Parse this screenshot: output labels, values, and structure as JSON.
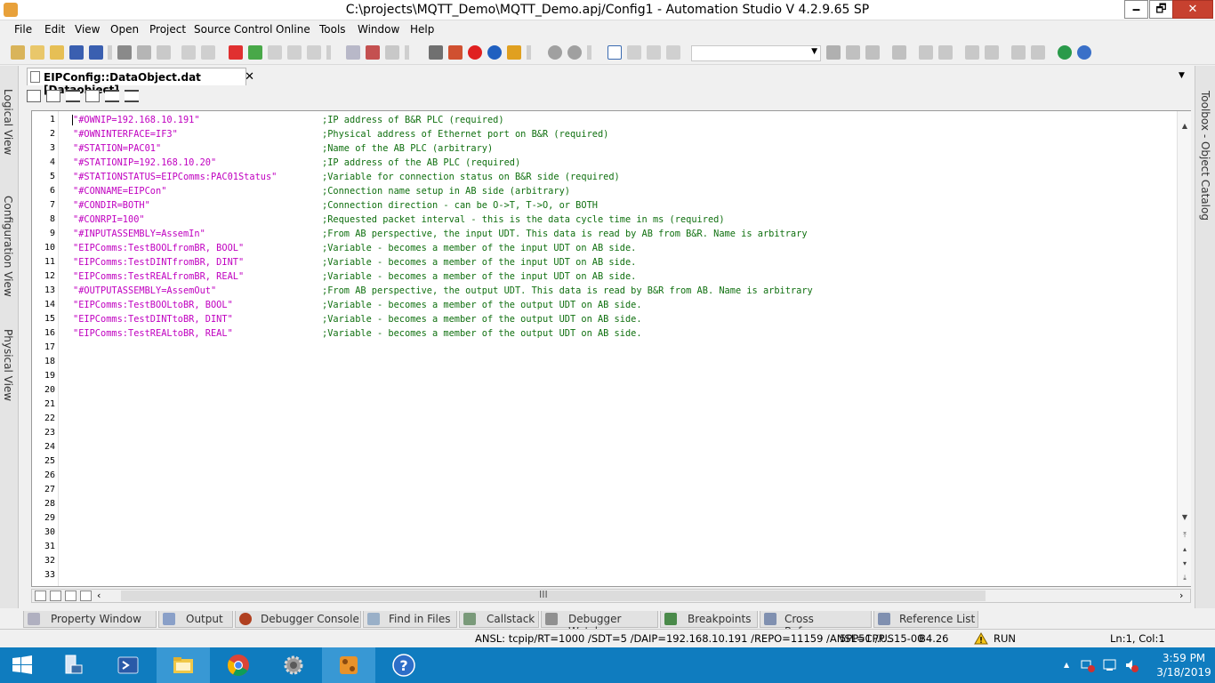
{
  "window": {
    "title": "C:\\projects\\MQTT_Demo\\MQTT_Demo.apj/Config1 - Automation Studio V 4.2.9.65 SP",
    "minimize": "🗕",
    "maximize": "🗗",
    "close": "✕"
  },
  "menu": [
    "File",
    "Edit",
    "View",
    "Open",
    "Project",
    "Source Control",
    "Online",
    "Tools",
    "Window",
    "Help"
  ],
  "side_panels": {
    "left": [
      "Logical View",
      "Configuration View",
      "Physical View"
    ],
    "right": [
      "Toolbox - Object Catalog"
    ]
  },
  "document_tab": {
    "label": "EIPConfig::DataObject.dat [Dataobject]",
    "close": "✕"
  },
  "editor": {
    "line_numbers": [
      "1",
      "2",
      "3",
      "4",
      "5",
      "6",
      "7",
      "8",
      "9",
      "10",
      "11",
      "12",
      "13",
      "14",
      "15",
      "16",
      "17",
      "18",
      "19",
      "20",
      "21",
      "22",
      "23",
      "24",
      "25",
      "26",
      "27",
      "28",
      "29",
      "30",
      "31",
      "32",
      "33"
    ],
    "lines": [
      {
        "code": "\"#OWNIP=192.168.10.191\"",
        "comment": ";IP address of B&R PLC (required)"
      },
      {
        "code": "\"#OWNINTERFACE=IF3\"",
        "comment": ";Physical address of Ethernet port on B&R (required)"
      },
      {
        "code": "\"#STATION=PAC01\"",
        "comment": ";Name of the AB PLC (arbitrary)"
      },
      {
        "code": "\"#STATIONIP=192.168.10.20\"",
        "comment": ";IP address of the AB PLC (required)"
      },
      {
        "code": "\"#STATIONSTATUS=EIPComms:PAC01Status\"",
        "comment": ";Variable for connection status on B&R side (required)"
      },
      {
        "code": "\"#CONNAME=EIPCon\"",
        "comment": ";Connection name setup in AB side (arbitrary)"
      },
      {
        "code": "\"#CONDIR=BOTH\"",
        "comment": ";Connection direction - can be O->T, T->O, or BOTH"
      },
      {
        "code": "\"#CONRPI=100\"",
        "comment": ";Requested packet interval - this is the data cycle time in ms (required)"
      },
      {
        "code": "\"#INPUTASSEMBLY=AssemIn\"",
        "comment": ";From AB perspective, the input UDT. This data is read by AB from B&R. Name is arbitrary"
      },
      {
        "code": "\"EIPComms:TestBOOLfromBR, BOOL\"",
        "comment": ";Variable - becomes a member of the input UDT on AB side."
      },
      {
        "code": "\"EIPComms:TestDINTfromBR, DINT\"",
        "comment": ";Variable - becomes a member of the input UDT on AB side."
      },
      {
        "code": "\"EIPComms:TestREALfromBR, REAL\"",
        "comment": ";Variable - becomes a member of the input UDT on AB side."
      },
      {
        "code": "\"#OUTPUTASSEMBLY=AssemOut\"",
        "comment": ";From AB perspective, the output UDT. This data is read by B&R from AB. Name is arbitrary"
      },
      {
        "code": "\"EIPComms:TestBOOLtoBR, BOOL\"",
        "comment": ";Variable - becomes a member of the output UDT on AB side."
      },
      {
        "code": "\"EIPComms:TestDINTtoBR, DINT\"",
        "comment": ";Variable - becomes a member of the output UDT on AB side."
      },
      {
        "code": "\"EIPComms:TestREALtoBR, REAL\"",
        "comment": ";Variable - becomes a member of the output UDT on AB side."
      }
    ]
  },
  "bottom_tabs": [
    "Property Window",
    "Output",
    "Debugger Console",
    "Find in Files",
    "Callstack",
    "Debugger Watch",
    "Breakpoints",
    "Cross Reference",
    "Reference List"
  ],
  "status_bar": {
    "connection": "ANSL: tcpip/RT=1000 /SDT=5 /DAIP=192.168.10.191 /REPO=11159 /ANSL=1 /P...",
    "target": "5PP5CP.US15-00",
    "version": "B4.26",
    "mode": "RUN",
    "position": "Ln:1, Col:1"
  },
  "taskbar": {
    "time": "3:59 PM",
    "date": "3/18/2019",
    "tray_arrow": "▲"
  },
  "colors": {
    "code": "#c000c0",
    "comment": "#107010",
    "taskbar": "#0f7cbf",
    "close_button": "#c7412f"
  },
  "icons": {
    "app": "automation-studio-icon",
    "warning": "warning-icon",
    "start": "windows-start-icon"
  }
}
